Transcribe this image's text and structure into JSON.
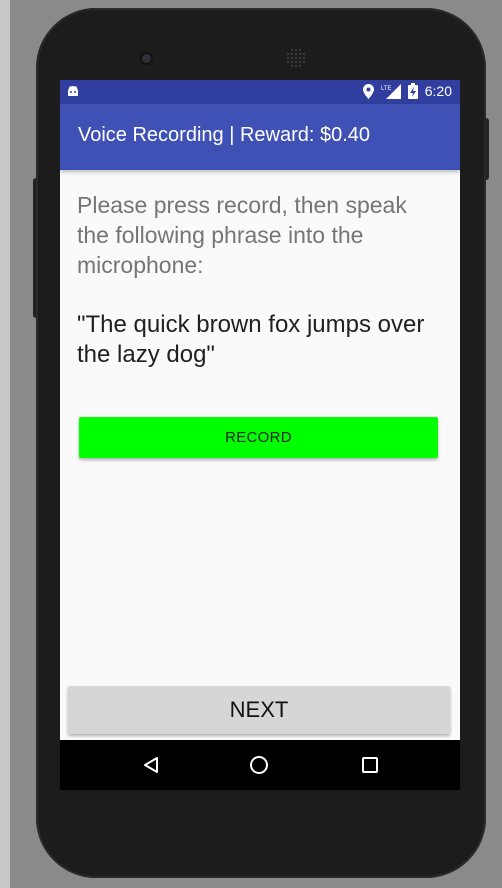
{
  "status_bar": {
    "time": "6:20",
    "icons": [
      "android-icon",
      "location-icon",
      "lte-signal-icon",
      "battery-charging-icon"
    ],
    "lte_label": "LTE"
  },
  "app_bar": {
    "title": "Voice Recording | Reward: $0.40"
  },
  "content": {
    "instruction": "Please press record, then speak the following phrase into the microphone:",
    "phrase": "\"The quick brown fox jumps over the lazy dog\"",
    "record_label": "RECORD",
    "record_color": "#00ff00"
  },
  "footer": {
    "next_label": "NEXT"
  },
  "nav_bar": {
    "icons": [
      "back-icon",
      "home-icon",
      "recents-icon"
    ]
  },
  "colors": {
    "primary": "#3f51b5",
    "primary_dark": "#303f9f",
    "background": "#fafafa"
  }
}
